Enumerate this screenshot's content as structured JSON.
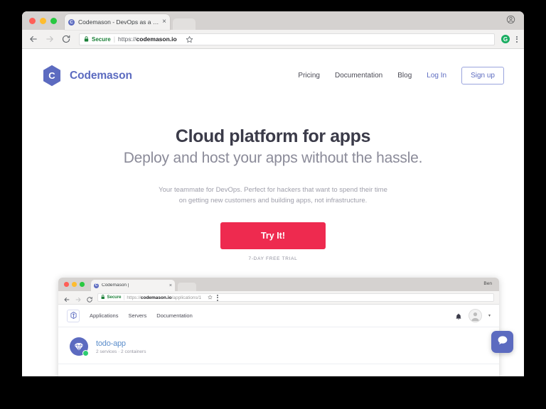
{
  "browser": {
    "tab": {
      "title": "Codemason - DevOps as a Ser",
      "favicon_letter": "C",
      "close_label": "×"
    },
    "toolbar": {
      "back_icon": "back-arrow-icon",
      "forward_icon": "forward-arrow-icon",
      "reload_icon": "reload-icon",
      "secure_label": "Secure",
      "separator": "|",
      "url_scheme": "https://",
      "url_host": "codemason.io",
      "url_path": "",
      "star_icon": "bookmark-star-icon",
      "extension_letter": "G",
      "menu_icon": "three-dot-menu-icon",
      "profile_icon": "profile-icon"
    }
  },
  "site": {
    "brand": {
      "logo_letter": "C",
      "name": "Codemason"
    },
    "nav": [
      {
        "label": "Pricing",
        "accent": false
      },
      {
        "label": "Documentation",
        "accent": false
      },
      {
        "label": "Blog",
        "accent": false
      },
      {
        "label": "Log In",
        "accent": true
      }
    ],
    "signup_label": "Sign up",
    "hero": {
      "headline": "Cloud platform for apps",
      "subheadline": "Deploy and host your apps without the hassle.",
      "description_line1": "Your teammate for DevOps. Perfect for hackers that want to spend their time",
      "description_line2": "on getting new customers and building apps, not infrastructure.",
      "cta_label": "Try It!",
      "trial_note": "7-DAY FREE TRIAL"
    }
  },
  "screenshot": {
    "browser": {
      "tab_title": "Codemason |",
      "tab_favicon_letter": "C",
      "tab_close": "×",
      "user_label": "Ben",
      "secure_label": "Secure",
      "separator": "|",
      "url_scheme": "https://",
      "url_host": "codemason.io",
      "url_path": "/applications/1"
    },
    "app": {
      "nav": [
        {
          "label": "Applications"
        },
        {
          "label": "Servers"
        },
        {
          "label": "Documentation"
        }
      ],
      "bell_icon": "bell-icon",
      "avatar_icon": "avatar-icon",
      "caret": "▾",
      "application": {
        "name": "todo-app",
        "meta": "2 services · 2 containers",
        "icon": "gem-icon",
        "status": "online"
      }
    }
  },
  "chat": {
    "icon": "chat-bubble-icon"
  },
  "colors": {
    "brand_purple": "#5c6bc0",
    "cta_red": "#ee2a4f",
    "secure_green": "#1a7f37",
    "status_green": "#2ecc71",
    "heading_dark": "#3b3b49",
    "subheading_gray": "#8b8b99"
  }
}
